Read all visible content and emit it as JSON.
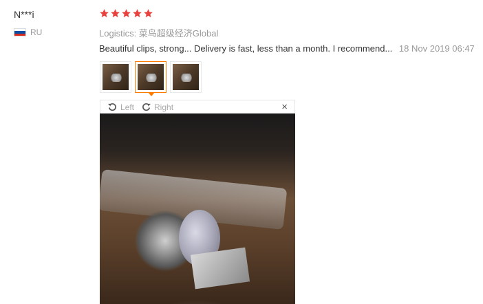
{
  "reviewer": {
    "name": "N***i",
    "country": "RU"
  },
  "rating": {
    "stars": 5,
    "color": "#e8413e"
  },
  "logistics": "Logistics: 菜鸟超级经济Global",
  "review": {
    "text": "Beautiful clips, strong... Delivery is fast, less than a month. I recommend...",
    "date": "18 Nov 2019 06:47"
  },
  "thumbnails": {
    "count": 3,
    "active_index": 1
  },
  "viewer": {
    "rotate_left_label": "Left",
    "rotate_right_label": "Right",
    "close_glyph": "×",
    "icons": [
      "rotate-left-icon",
      "rotate-right-icon",
      "close-icon"
    ]
  },
  "colors": {
    "accent": "#ff7a00",
    "muted_text": "#999999"
  }
}
